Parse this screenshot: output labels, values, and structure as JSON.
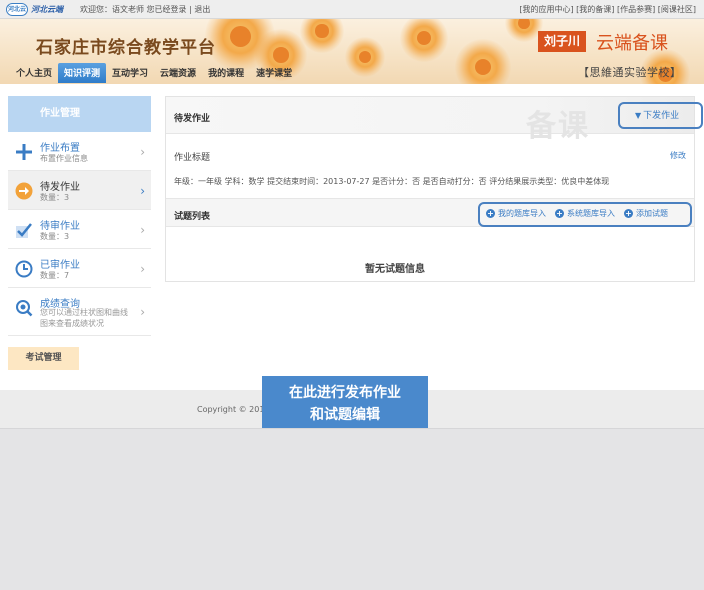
{
  "topbar": {
    "logo_badge": "河北云",
    "logo_text": "河北云端",
    "welcome": "欢迎您：语文老师 您已经登录",
    "logout": "退出",
    "links": "[我的应用中心] [我的备课] [作品参赛] [阅课社区]"
  },
  "header": {
    "platform_title": "石家庄市综合教学平台",
    "teacher": "刘子川",
    "brand": "云端备课",
    "school": "【思維通实验学校】",
    "nav": [
      "个人主页",
      "知识评测",
      "互动学习",
      "云端资源",
      "我的课程",
      "速学课堂"
    ],
    "active_nav": "知识评测"
  },
  "sidebar": {
    "header": "作业管理",
    "items": [
      {
        "title": "作业布置",
        "sub": "布置作业信息",
        "icon": "plus-icon",
        "active": false
      },
      {
        "title": "待发作业",
        "sub": "数量：3",
        "icon": "arrow-right-icon",
        "active": true
      },
      {
        "title": "待审作业",
        "sub": "数量：3",
        "icon": "check-icon",
        "active": false
      },
      {
        "title": "已审作业",
        "sub": "数量：7",
        "icon": "clock-icon",
        "active": false
      },
      {
        "title": "成绩查询",
        "sub": "您可以通过柱状图和曲线图来查看成绩状况",
        "icon": "search-icon",
        "active": false
      }
    ],
    "exam_button": "考试管理"
  },
  "content": {
    "title": "待发作业",
    "ghost": "备课",
    "issue_label": "下发作业",
    "homework_title_label": "作业标题",
    "edit": "修改",
    "meta": "年级：一年级   学科：数学   提交结束时间：2013-07-27   是否计分：否   是否自动打分：否   评分结果展示类型：优良中差体现",
    "question_list": "试题列表",
    "actions": [
      "我的题库导入",
      "系统题库导入",
      "添加试题"
    ],
    "empty": "暂无试题信息"
  },
  "footer": {
    "copyright": "Copyright © 2012                                          冀ICP备12007424号"
  },
  "callout": {
    "line1": "在此进行发布作业",
    "line2": "和试题编辑"
  },
  "colors": {
    "accent": "#3a7cc4",
    "brand": "#d9531e",
    "callout": "#4a89cc"
  }
}
